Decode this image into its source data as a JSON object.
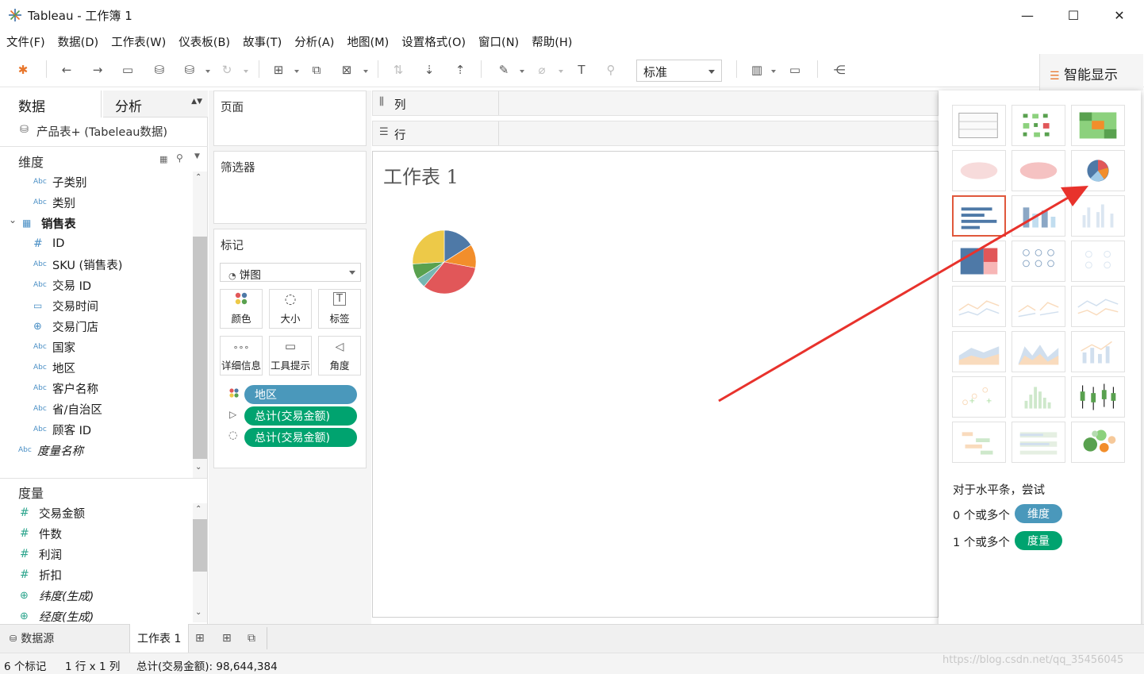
{
  "window": {
    "title": "Tableau - 工作簿 1",
    "minimize": "—",
    "maximize": "☐",
    "close": "✕"
  },
  "menu": [
    "文件(F)",
    "数据(D)",
    "工作表(W)",
    "仪表板(B)",
    "故事(T)",
    "分析(A)",
    "地图(M)",
    "设置格式(O)",
    "窗口(N)",
    "帮助(H)"
  ],
  "toolbar": {
    "fit_select": "标准",
    "smart_show": "智能显示"
  },
  "data_pane": {
    "tab_data": "数据",
    "tab_analysis": "分析",
    "datasource": "产品表+ (Tabeleau数据)",
    "dimensions_header": "维度",
    "dimensions": [
      {
        "icon": "Abc",
        "label": "子类别",
        "italic": false,
        "bold": false
      },
      {
        "icon": "Abc",
        "label": "类别",
        "italic": false,
        "bold": false
      },
      {
        "icon": "table",
        "label": "销售表",
        "italic": false,
        "bold": true
      },
      {
        "icon": "#",
        "label": "ID",
        "italic": false,
        "bold": false
      },
      {
        "icon": "Abc",
        "label": "SKU (销售表)",
        "italic": false,
        "bold": false
      },
      {
        "icon": "Abc",
        "label": "交易 ID",
        "italic": false,
        "bold": false
      },
      {
        "icon": "date",
        "label": "交易时间",
        "italic": false,
        "bold": false
      },
      {
        "icon": "globe",
        "label": "交易门店",
        "italic": false,
        "bold": false
      },
      {
        "icon": "Abc",
        "label": "国家",
        "italic": false,
        "bold": false
      },
      {
        "icon": "Abc",
        "label": "地区",
        "italic": false,
        "bold": false
      },
      {
        "icon": "Abc",
        "label": "客户名称",
        "italic": false,
        "bold": false
      },
      {
        "icon": "Abc",
        "label": "省/自治区",
        "italic": false,
        "bold": false
      },
      {
        "icon": "Abc",
        "label": "顾客 ID",
        "italic": false,
        "bold": false
      },
      {
        "icon": "Abc",
        "label": "度量名称",
        "italic": true,
        "bold": false
      }
    ],
    "measures_header": "度量",
    "measures": [
      {
        "icon": "#",
        "label": "交易金额",
        "italic": false
      },
      {
        "icon": "#",
        "label": "件数",
        "italic": false
      },
      {
        "icon": "#",
        "label": "利润",
        "italic": false
      },
      {
        "icon": "#",
        "label": "折扣",
        "italic": false
      },
      {
        "icon": "globe",
        "label": "纬度(生成)",
        "italic": true
      },
      {
        "icon": "globe",
        "label": "经度(生成)",
        "italic": true
      }
    ]
  },
  "shelves": {
    "pages": "页面",
    "filters": "筛选器",
    "marks": "标记",
    "mark_type": "饼图",
    "mark_buttons": [
      "颜色",
      "大小",
      "标签",
      "详细信息",
      "工具提示",
      "角度"
    ],
    "mark_pills": [
      "地区",
      "总计(交易金额)",
      "总计(交易金额)"
    ],
    "columns": "列",
    "rows": "行"
  },
  "sheet": {
    "title": "工作表 1"
  },
  "pie": {
    "slices": [
      {
        "value": 16,
        "color": "#4e79a7"
      },
      {
        "value": 12,
        "color": "#f28e2b"
      },
      {
        "value": 33,
        "color": "#e15759"
      },
      {
        "value": 5,
        "color": "#76b7b2"
      },
      {
        "value": 8,
        "color": "#59a14f"
      },
      {
        "value": 26,
        "color": "#edc948"
      }
    ]
  },
  "smart": {
    "hint": "对于水平条，尝试",
    "dim_req": "0 个或多个",
    "dim_pill": "维度",
    "meas_req": "1 个或多个",
    "meas_pill": "度量"
  },
  "bottom": {
    "datasource_tab": "数据源",
    "sheet_tab": "工作表 1"
  },
  "status": {
    "marks": "6 个标记",
    "rowcol": "1 行 x 1 列",
    "sum": "总计(交易金额): 98,644,384",
    "watermark": "https://blog.csdn.net/qq_35456045"
  }
}
